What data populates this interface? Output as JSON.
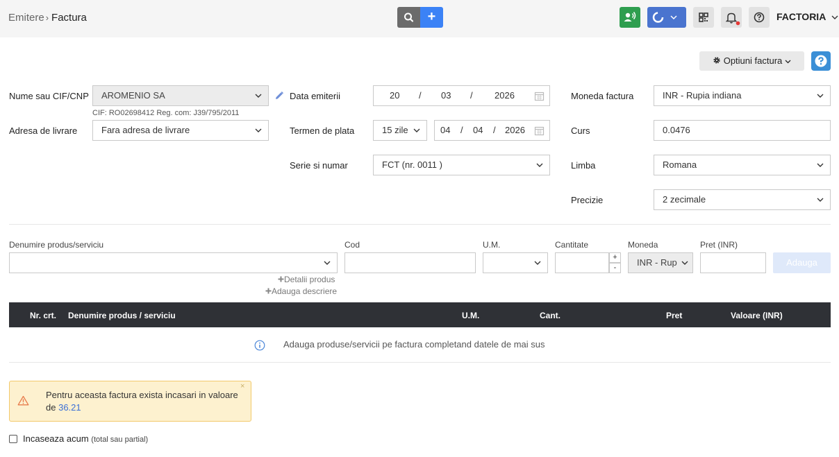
{
  "header": {
    "breadcrumb_parent": "Emitere",
    "breadcrumb_separator": "›",
    "breadcrumb_current": "Factura",
    "brand": "FACTORIA",
    "plus_label": "+"
  },
  "toolbar": {
    "optiuni_label": "Optiuni factura"
  },
  "client": {
    "name_label": "Nume sau CIF/CNP",
    "name_value": "AROMENIO SA",
    "cif_note": "CIF: RO02698412 Reg. com: J39/795/2011",
    "address_label": "Adresa de livrare",
    "address_value": "Fara adresa de livrare"
  },
  "dates": {
    "issue_label": "Data emiterii",
    "issue_day": "20",
    "issue_month": "03",
    "issue_year": "2026",
    "due_label": "Termen de plata",
    "due_term": "15 zile",
    "due_day": "04",
    "due_month": "04",
    "due_year": "2026",
    "date_separator": "/",
    "series_label": "Serie si numar",
    "series_value": "FCT (nr. 0011 )"
  },
  "currency": {
    "moneda_label": "Moneda factura",
    "moneda_value": "INR - Rupia indiana",
    "curs_label": "Curs",
    "curs_value": "0.0476",
    "limba_label": "Limba",
    "limba_value": "Romana",
    "precizie_label": "Precizie",
    "precizie_value": "2 zecimale"
  },
  "product_form": {
    "name_label": "Denumire produs/serviciu",
    "cod_label": "Cod",
    "um_label": "U.M.",
    "cantitate_label": "Cantitate",
    "moneda_label": "Moneda",
    "pret_label": "Pret (INR)",
    "moneda_value": "INR  -  Rupia indiana",
    "stepper_plus": "+",
    "stepper_minus": "-",
    "add_button": "Adauga",
    "details_link": "Detalii produs",
    "description_link": "Adauga descriere"
  },
  "table": {
    "columns": [
      "Nr. crt.",
      "Denumire produs / serviciu",
      "U.M.",
      "Cant.",
      "Pret",
      "Valoare (INR)"
    ],
    "empty_message": "Adauga produse/servicii pe factura completand datele de mai sus"
  },
  "alert": {
    "text": "Pentru aceasta factura exista incasari in valoare de",
    "amount": "36.21",
    "close": "×"
  },
  "payment": {
    "checkbox_label": "Incaseaza acum",
    "checkbox_sub": "(total sau partial)"
  },
  "colors": {
    "accent_blue": "#3b82f6",
    "green_button": "#2e9e4f",
    "table_header": "#2f3136",
    "alert_bg": "#fdf1cf"
  }
}
